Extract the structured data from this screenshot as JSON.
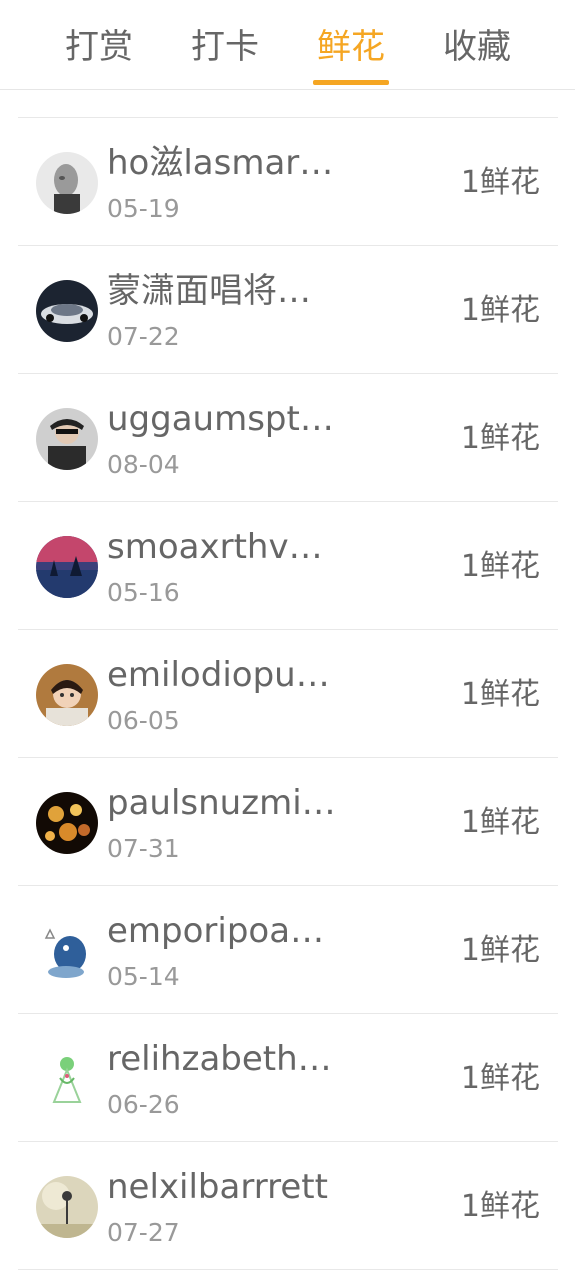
{
  "tabs": [
    {
      "label": "打赏"
    },
    {
      "label": "打卡"
    },
    {
      "label": "鲜花"
    },
    {
      "label": "收藏"
    }
  ],
  "active_tab": "鲜花",
  "accent_color": "#f5a623",
  "records": [
    {
      "name": "ho滋lasmartin",
      "date": "05-19",
      "amount": "1鲜花"
    },
    {
      "name": "蒙潇面唱将军令",
      "date": "07-22",
      "amount": "1鲜花"
    },
    {
      "name": "uggaumsptmeto",
      "date": "08-04",
      "amount": "1鲜花"
    },
    {
      "name": "smoaxrthvfinan",
      "date": "05-16",
      "amount": "1鲜花"
    },
    {
      "name": "emilodiopulsati",
      "date": "06-05",
      "amount": "1鲜花"
    },
    {
      "name": "paulsnuzmizzle",
      "date": "07-31",
      "amount": "1鲜花"
    },
    {
      "name": "emporipoarizone",
      "date": "05-14",
      "amount": "1鲜花"
    },
    {
      "name": "relihzabethwell",
      "date": "06-26",
      "amount": "1鲜花"
    },
    {
      "name": "nelxilbarrrett",
      "date": "07-27",
      "amount": "1鲜花"
    }
  ]
}
